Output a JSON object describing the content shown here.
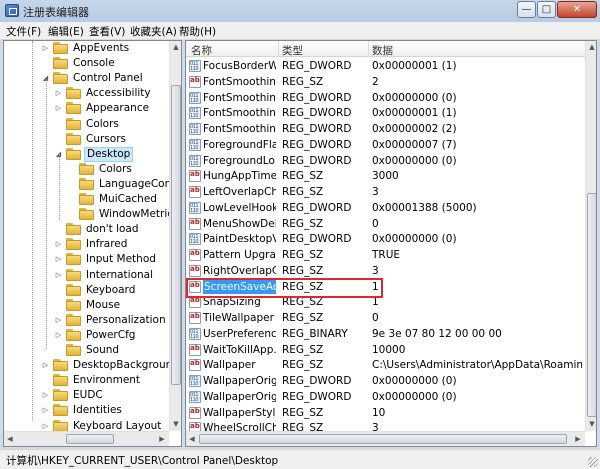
{
  "window": {
    "title": "注册表编辑器",
    "min_glyph": "—",
    "max_glyph": "□",
    "close_glyph": "✕"
  },
  "menu": [
    "文件(F)",
    "编辑(E)",
    "查看(V)",
    "收藏夹(A)",
    "帮助(H)"
  ],
  "tree": {
    "items": [
      {
        "label": "AppEvents",
        "expander": "▷"
      },
      {
        "label": "Console",
        "expander": ""
      },
      {
        "label": "Control Panel",
        "expander": "◢"
      },
      {
        "label": "Accessibility",
        "expander": "▷"
      },
      {
        "label": "Appearance",
        "expander": "▷"
      },
      {
        "label": "Colors",
        "expander": ""
      },
      {
        "label": "Cursors",
        "expander": ""
      },
      {
        "label": "Desktop",
        "expander": "◢"
      },
      {
        "label": "Colors",
        "expander": ""
      },
      {
        "label": "LanguageConfig",
        "expander": ""
      },
      {
        "label": "MuiCached",
        "expander": ""
      },
      {
        "label": "WindowMetrics",
        "expander": ""
      },
      {
        "label": "don't load",
        "expander": ""
      },
      {
        "label": "Infrared",
        "expander": "▷"
      },
      {
        "label": "Input Method",
        "expander": "▷"
      },
      {
        "label": "International",
        "expander": "▷"
      },
      {
        "label": "Keyboard",
        "expander": ""
      },
      {
        "label": "Mouse",
        "expander": ""
      },
      {
        "label": "Personalization",
        "expander": "▷"
      },
      {
        "label": "PowerCfg",
        "expander": "▷"
      },
      {
        "label": "Sound",
        "expander": ""
      },
      {
        "label": "DesktopBackground",
        "expander": "▷"
      },
      {
        "label": "Environment",
        "expander": ""
      },
      {
        "label": "EUDC",
        "expander": "▷"
      },
      {
        "label": "Identities",
        "expander": "▷"
      },
      {
        "label": "Keyboard Layout",
        "expander": "▷"
      }
    ],
    "selected": "Desktop"
  },
  "list": {
    "columns": [
      "名称",
      "类型",
      "数据"
    ],
    "rows": [
      {
        "name": "FocusBorderW...",
        "type": "REG_DWORD",
        "data": "0x00000001 (1)",
        "icon": "bin"
      },
      {
        "name": "FontSmoothing",
        "type": "REG_SZ",
        "data": "2",
        "icon": "str"
      },
      {
        "name": "FontSmoothin...",
        "type": "REG_DWORD",
        "data": "0x00000000 (0)",
        "icon": "bin"
      },
      {
        "name": "FontSmoothin...",
        "type": "REG_DWORD",
        "data": "0x00000001 (1)",
        "icon": "bin"
      },
      {
        "name": "FontSmoothin...",
        "type": "REG_DWORD",
        "data": "0x00000002 (2)",
        "icon": "bin"
      },
      {
        "name": "ForegroundFla...",
        "type": "REG_DWORD",
        "data": "0x00000007 (7)",
        "icon": "bin"
      },
      {
        "name": "ForegroundLo...",
        "type": "REG_DWORD",
        "data": "0x00000000 (0)",
        "icon": "bin"
      },
      {
        "name": "HungAppTime...",
        "type": "REG_SZ",
        "data": "3000",
        "icon": "str"
      },
      {
        "name": "LeftOverlapCh...",
        "type": "REG_SZ",
        "data": "3",
        "icon": "str"
      },
      {
        "name": "LowLevelHook...",
        "type": "REG_DWORD",
        "data": "0x00001388 (5000)",
        "icon": "bin"
      },
      {
        "name": "MenuShowDelay",
        "type": "REG_SZ",
        "data": "0",
        "icon": "str"
      },
      {
        "name": "PaintDesktopV...",
        "type": "REG_DWORD",
        "data": "0x00000000 (0)",
        "icon": "bin"
      },
      {
        "name": "Pattern Upgra...",
        "type": "REG_SZ",
        "data": "TRUE",
        "icon": "str"
      },
      {
        "name": "RightOverlapC...",
        "type": "REG_SZ",
        "data": "3",
        "icon": "str"
      },
      {
        "name": "ScreenSaveActi...",
        "type": "REG_SZ",
        "data": "1",
        "icon": "str"
      },
      {
        "name": "SnapSizing",
        "type": "REG_SZ",
        "data": "1",
        "icon": "str"
      },
      {
        "name": "TileWallpaper",
        "type": "REG_SZ",
        "data": "0",
        "icon": "str"
      },
      {
        "name": "UserPreferenc...",
        "type": "REG_BINARY",
        "data": "9e 3e 07 80 12 00 00 00",
        "icon": "bin"
      },
      {
        "name": "WaitToKillApp...",
        "type": "REG_SZ",
        "data": "10000",
        "icon": "str"
      },
      {
        "name": "Wallpaper",
        "type": "REG_SZ",
        "data": "C:\\Users\\Administrator\\AppData\\Roaming\\Mi...",
        "icon": "str"
      },
      {
        "name": "WallpaperOrig...",
        "type": "REG_DWORD",
        "data": "0x00000000 (0)",
        "icon": "bin"
      },
      {
        "name": "WallpaperOrig...",
        "type": "REG_DWORD",
        "data": "0x00000000 (0)",
        "icon": "bin"
      },
      {
        "name": "WallpaperStyle",
        "type": "REG_SZ",
        "data": "10",
        "icon": "str"
      },
      {
        "name": "WheelScrollCh...",
        "type": "REG_SZ",
        "data": "3",
        "icon": "str"
      }
    ],
    "selected_name": "ScreenSaveActi..."
  },
  "status": {
    "path": "计算机\\HKEY_CURRENT_USER\\Control Panel\\Desktop"
  },
  "colors": {
    "selection": "#3399ff",
    "highlight_box": "#e0282a",
    "tree_selection": "#cde8fb"
  }
}
